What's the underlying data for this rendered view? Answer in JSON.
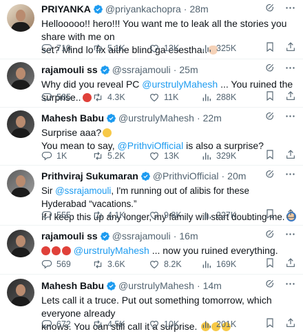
{
  "tweets": [
    {
      "name": "PRIYANKA",
      "handle": "@priyankachopra",
      "dot": "·",
      "time": "28m",
      "text_lines": [
        "Hellooooo!! hero!!! You want me to leak all the stories you share with me on",
        "set? Mind lo fix aithe blind ga esestha.."
      ],
      "emoji": "🙌🏻",
      "stats": {
        "replies": "710",
        "reposts": "5.1K",
        "likes": "13K",
        "views": "325K"
      }
    },
    {
      "name": "rajamouli ss",
      "handle": "@ssrajamouli",
      "dot": "·",
      "time": "25m",
      "pre": "Why did you reveal PC ",
      "mention": "@urstrulyMahesh",
      "post": " ... You ruined the surprise..",
      "emoji": "😡",
      "stats": {
        "replies": "585",
        "reposts": "4.3K",
        "likes": "11K",
        "views": "288K"
      }
    },
    {
      "name": "Mahesh Babu",
      "handle": "@urstrulyMahesh",
      "dot": "·",
      "time": "22m",
      "line1": "Surprise aaa?",
      "emoji": "😳",
      "line2_pre": "You mean to say, ",
      "mention": "@PrithviOfficial",
      "line2_post": " is also a surprise?",
      "stats": {
        "replies": "1K",
        "reposts": "5.2K",
        "likes": "13K",
        "views": "329K"
      }
    },
    {
      "name": "Prithviraj Sukumaran",
      "handle": "@PrithviOfficial",
      "dot": "·",
      "time": "20m",
      "pre": "Sir ",
      "mention": "@ssrajamouli",
      "post": ", I'm running out of alibis for these Hyderabad “vacations.”",
      "line2": "If I keep this up any longer, my family will start doubting me.",
      "emoji": "🧑‍🦲",
      "stats": {
        "replies": "555",
        "reposts": "4.1K",
        "likes": "9.8K",
        "views": "227K"
      }
    },
    {
      "name": "rajamouli ss",
      "handle": "@ssrajamouli",
      "dot": "·",
      "time": "16m",
      "emoji": "😡😡😡",
      "mention": "@urstrulyMahesh",
      "post": " ... now you ruined everything.",
      "stats": {
        "replies": "569",
        "reposts": "3.6K",
        "likes": "8.2K",
        "views": "169K"
      }
    },
    {
      "name": "Mahesh Babu",
      "handle": "@urstrulyMahesh",
      "dot": "·",
      "time": "14m",
      "text_lines": [
        "Lets call it a truce. Put out something tomorrow, which everyone already",
        "knows.  You can still call it a surprise."
      ],
      "emoji": "😂😂😂",
      "stats": {
        "replies": "672",
        "reposts": "4.5K",
        "likes": "10K",
        "views": "201K"
      }
    }
  ],
  "icons": {
    "verified": "verified-badge-icon",
    "grok": "grok-icon",
    "more": "more-icon",
    "reply": "reply-icon",
    "repost": "repost-icon",
    "like": "like-icon",
    "views": "views-icon",
    "bookmark": "bookmark-icon",
    "share": "share-icon"
  },
  "colors": {
    "accent": "#1d9bf0",
    "muted": "#536471",
    "text": "#0f1419",
    "divider": "#eff3f4"
  }
}
